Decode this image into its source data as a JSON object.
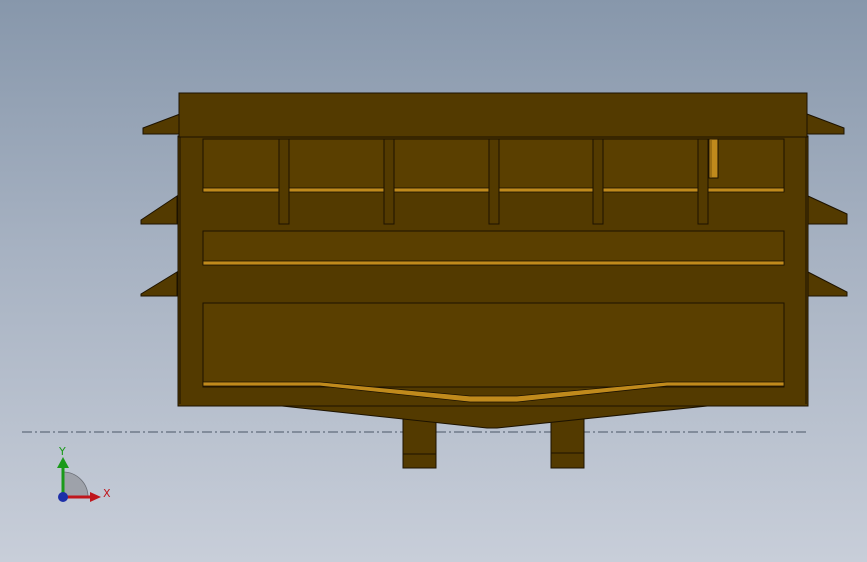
{
  "colors": {
    "body": "#533a00",
    "face": "#5a3f00",
    "edge": "#1c1200",
    "highlight": "#c08a1c",
    "centerline": "#4a5566",
    "axis_x": "#c0161c",
    "axis_y": "#1a9a1a",
    "axis_z": "#1d2fa8"
  },
  "triad": {
    "x_label": "X",
    "y_label": "Y"
  }
}
